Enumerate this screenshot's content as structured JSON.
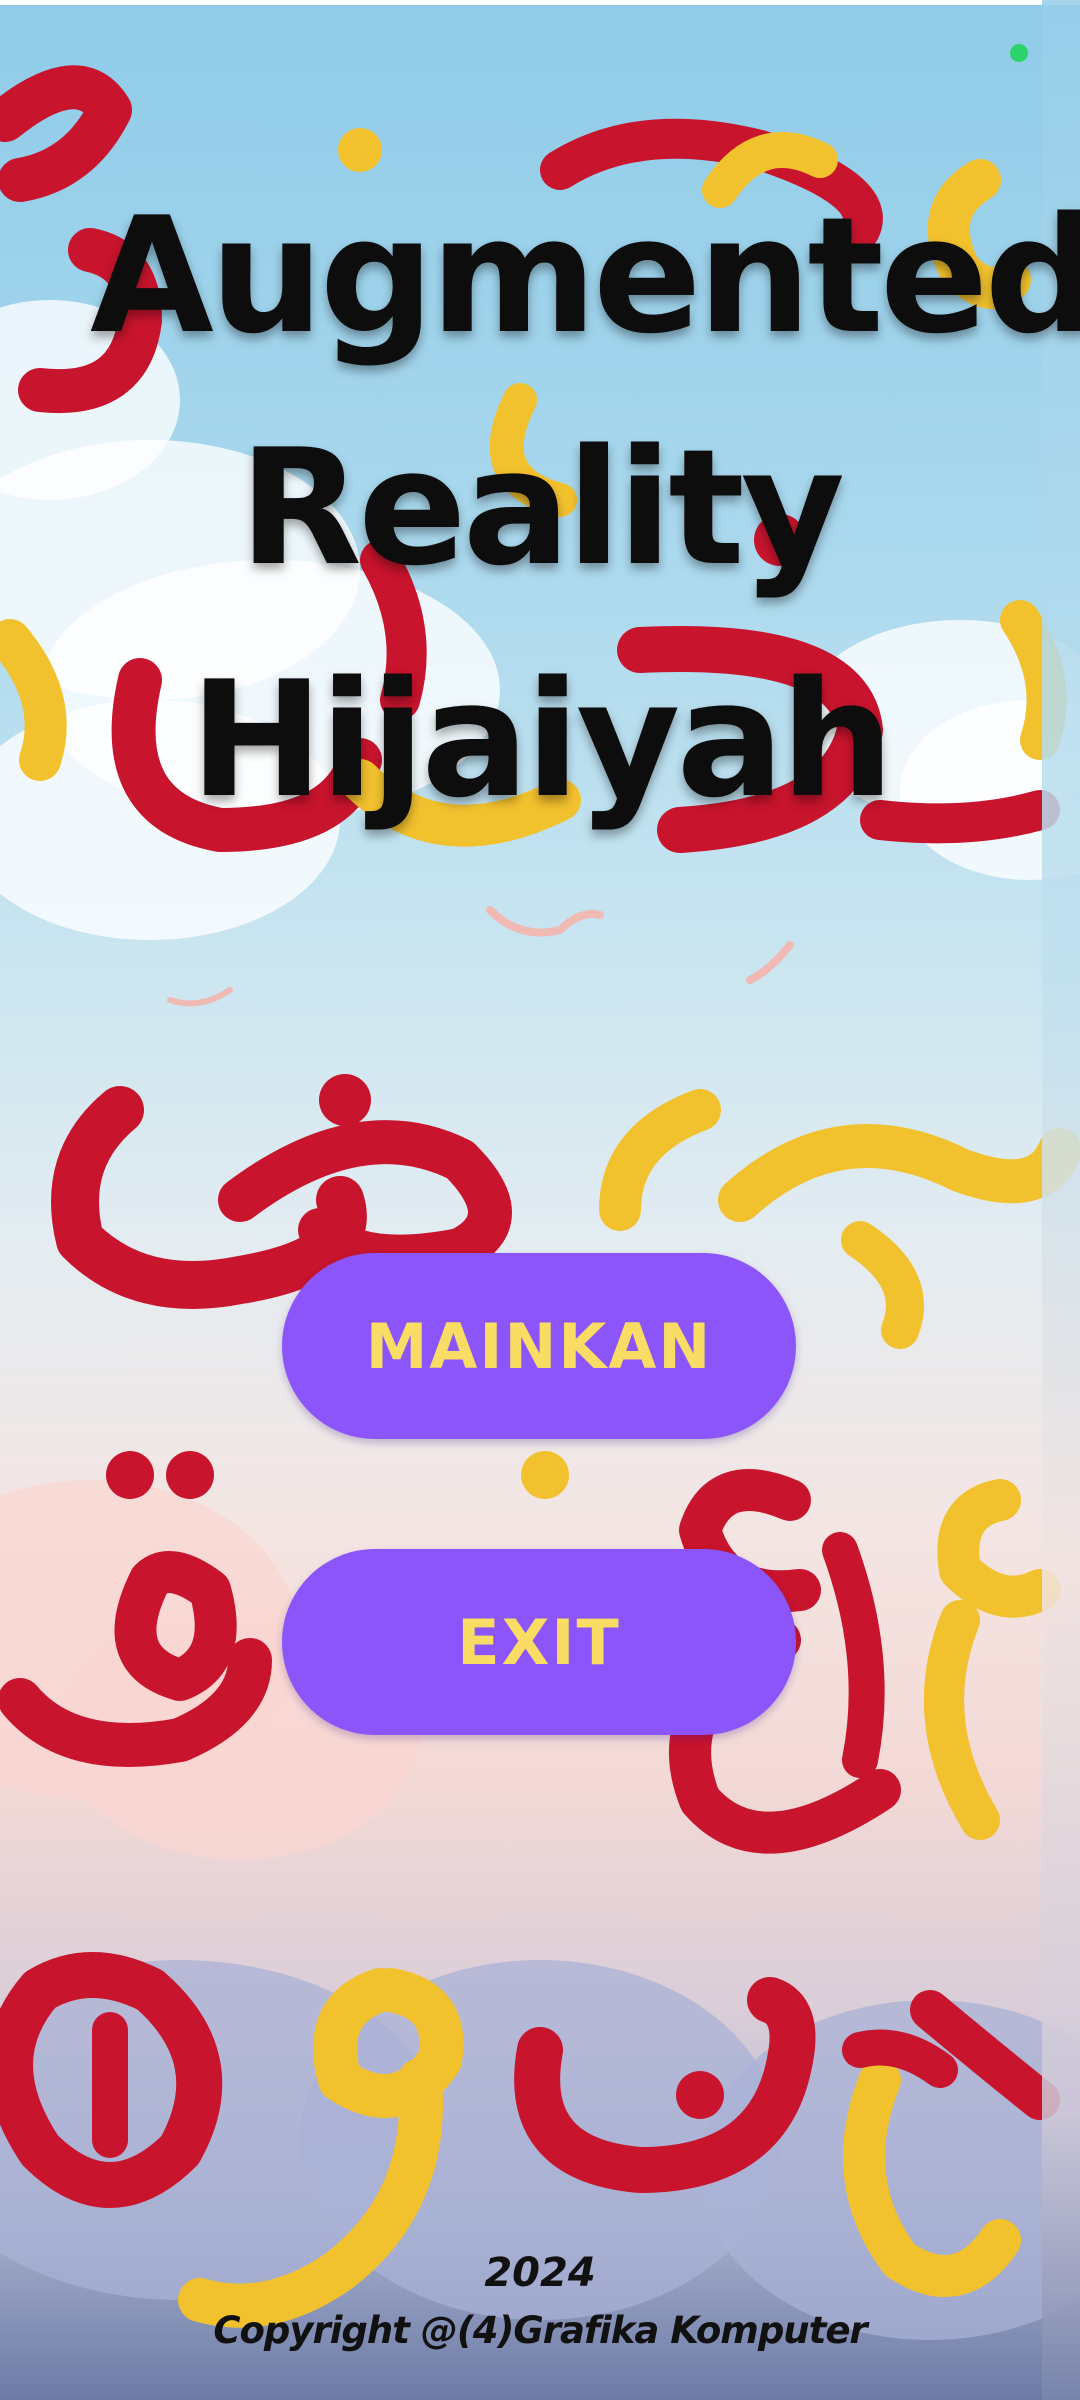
{
  "app": {
    "title_lines": [
      "Augmented",
      "Reality",
      "Hijaiyah"
    ]
  },
  "status": {
    "indicator_color": "#2bd36a"
  },
  "menu": {
    "play_label": "MAINKAN",
    "exit_label": "EXIT",
    "button_color": "#8b55fa",
    "label_color": "#f9dc63"
  },
  "footer": {
    "year": "2024",
    "copyright": "Copyright @(4)Grafika Komputer"
  }
}
